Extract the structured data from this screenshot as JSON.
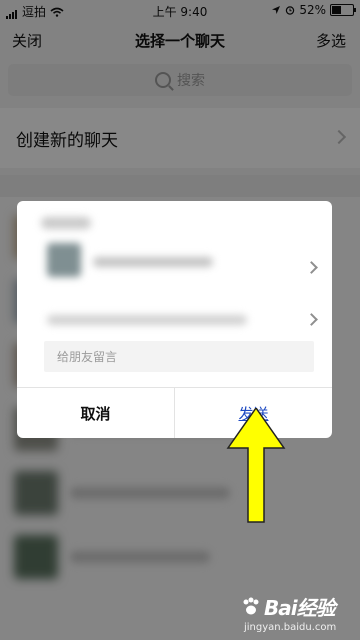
{
  "status_bar": {
    "carrier": "逗拍",
    "time": "上午 9:40",
    "battery": "52%",
    "battery_level": 0.52
  },
  "navbar": {
    "close_label": "关闭",
    "title": "选择一个聊天",
    "multi_select_label": "多选"
  },
  "search": {
    "placeholder": "搜索"
  },
  "new_chat": {
    "label": "创建新的聊天"
  },
  "dialog": {
    "message_placeholder": "给朋友留言",
    "cancel_label": "取消",
    "send_label": "发送"
  },
  "annotation": {
    "arrow_color": "#ffff00"
  },
  "watermark": {
    "brand": "Bai经验",
    "url": "jingyan.baidu.com"
  },
  "colors": {
    "send": "#1d49c2",
    "background": "#ededed"
  }
}
